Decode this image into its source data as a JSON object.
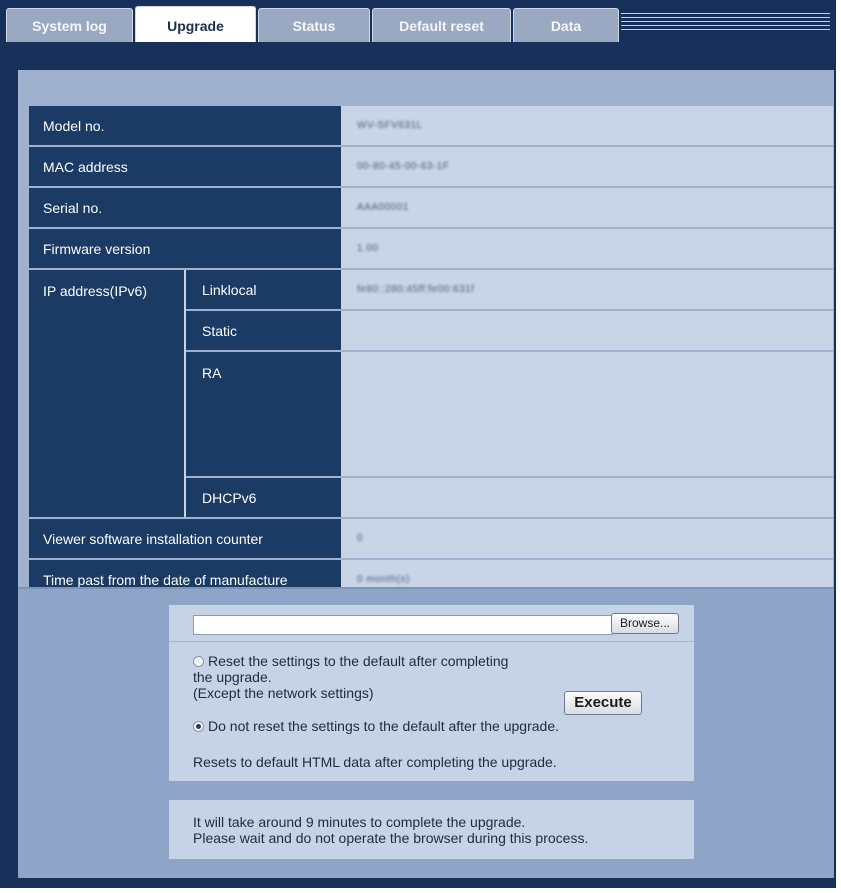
{
  "tabs": [
    {
      "label": "System log",
      "active": false
    },
    {
      "label": "Upgrade",
      "active": true
    },
    {
      "label": "Status",
      "active": false
    },
    {
      "label": "Default reset",
      "active": false
    },
    {
      "label": "Data",
      "active": false
    }
  ],
  "info": {
    "model_no": {
      "label": "Model no.",
      "value": "WV-SFV631L"
    },
    "mac_address": {
      "label": "MAC address",
      "value": "00-80-45-00-63-1F"
    },
    "serial_no": {
      "label": "Serial no.",
      "value": "AAA00001"
    },
    "firmware_version": {
      "label": "Firmware version",
      "value": "1.00"
    },
    "ipv6": {
      "label": "IP address(IPv6)",
      "linklocal": {
        "label": "Linklocal",
        "value": "fe80::280:45ff:fe00:631f"
      },
      "static": {
        "label": "Static",
        "value": ""
      },
      "ra": {
        "label": "RA",
        "value": ""
      },
      "dhcpv6": {
        "label": "DHCPv6",
        "value": ""
      }
    },
    "viewer_counter": {
      "label": "Viewer software installation counter",
      "value": "0"
    },
    "time_past": {
      "label": "Time past from the date of manufacture",
      "value": "0 month(s)"
    }
  },
  "upgrade": {
    "file_value": "",
    "browse_label": "Browse...",
    "option_reset_line1": "Reset the settings to the default after completing",
    "option_reset_line2": "the upgrade.",
    "option_reset_line3": "(Except the network settings)",
    "option_keep": "Do not reset the settings to the default after the upgrade.",
    "selected_option": "keep",
    "html_note": "Resets to default HTML data after completing the upgrade.",
    "execute_label": "Execute",
    "notice_line1": "It will take around 9 minutes to complete the upgrade.",
    "notice_line2": "Please wait and do not operate the browser during this process."
  },
  "colors": {
    "tab_bar": "#163059",
    "label_cell": "#1b3a64",
    "value_cell": "#c9d5e7",
    "area_bg": "#9fb1ce",
    "upgrade_bg": "#8fa5c8"
  }
}
